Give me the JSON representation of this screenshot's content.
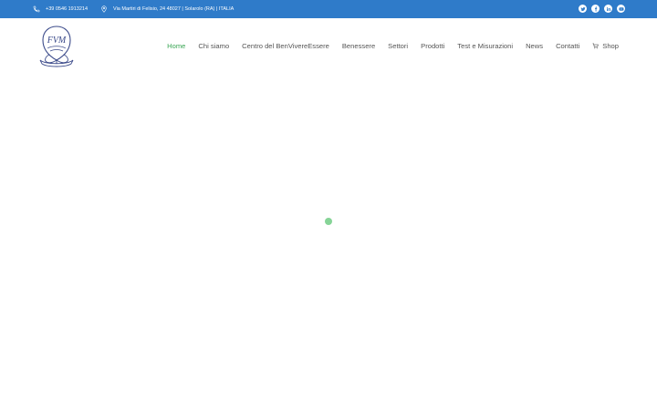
{
  "topbar": {
    "phone": "+39 0546 1913214",
    "address": "Via Martiri di Felisio, 24 48027 | Solarolo (RA) | ITALIA",
    "background": "#2f7bc9",
    "social": [
      {
        "name": "twitter-icon"
      },
      {
        "name": "facebook-icon"
      },
      {
        "name": "linkedin-icon"
      },
      {
        "name": "youtube-icon"
      }
    ]
  },
  "logo": {
    "monogram": "FVM",
    "icon": "crest-logo-icon"
  },
  "nav": {
    "items": [
      {
        "label": "Home",
        "active": true
      },
      {
        "label": "Chi siamo"
      },
      {
        "label": "Centro del BenVivereEssere"
      },
      {
        "label": "Benessere"
      },
      {
        "label": "Settori"
      },
      {
        "label": "Prodotti"
      },
      {
        "label": "Test e Misurazioni"
      },
      {
        "label": "News"
      },
      {
        "label": "Contatti"
      },
      {
        "label": "Shop",
        "icon": "cart-icon"
      }
    ],
    "active_color": "#3aa654",
    "text_color": "#555555"
  },
  "loader": {
    "color": "#86d497"
  }
}
